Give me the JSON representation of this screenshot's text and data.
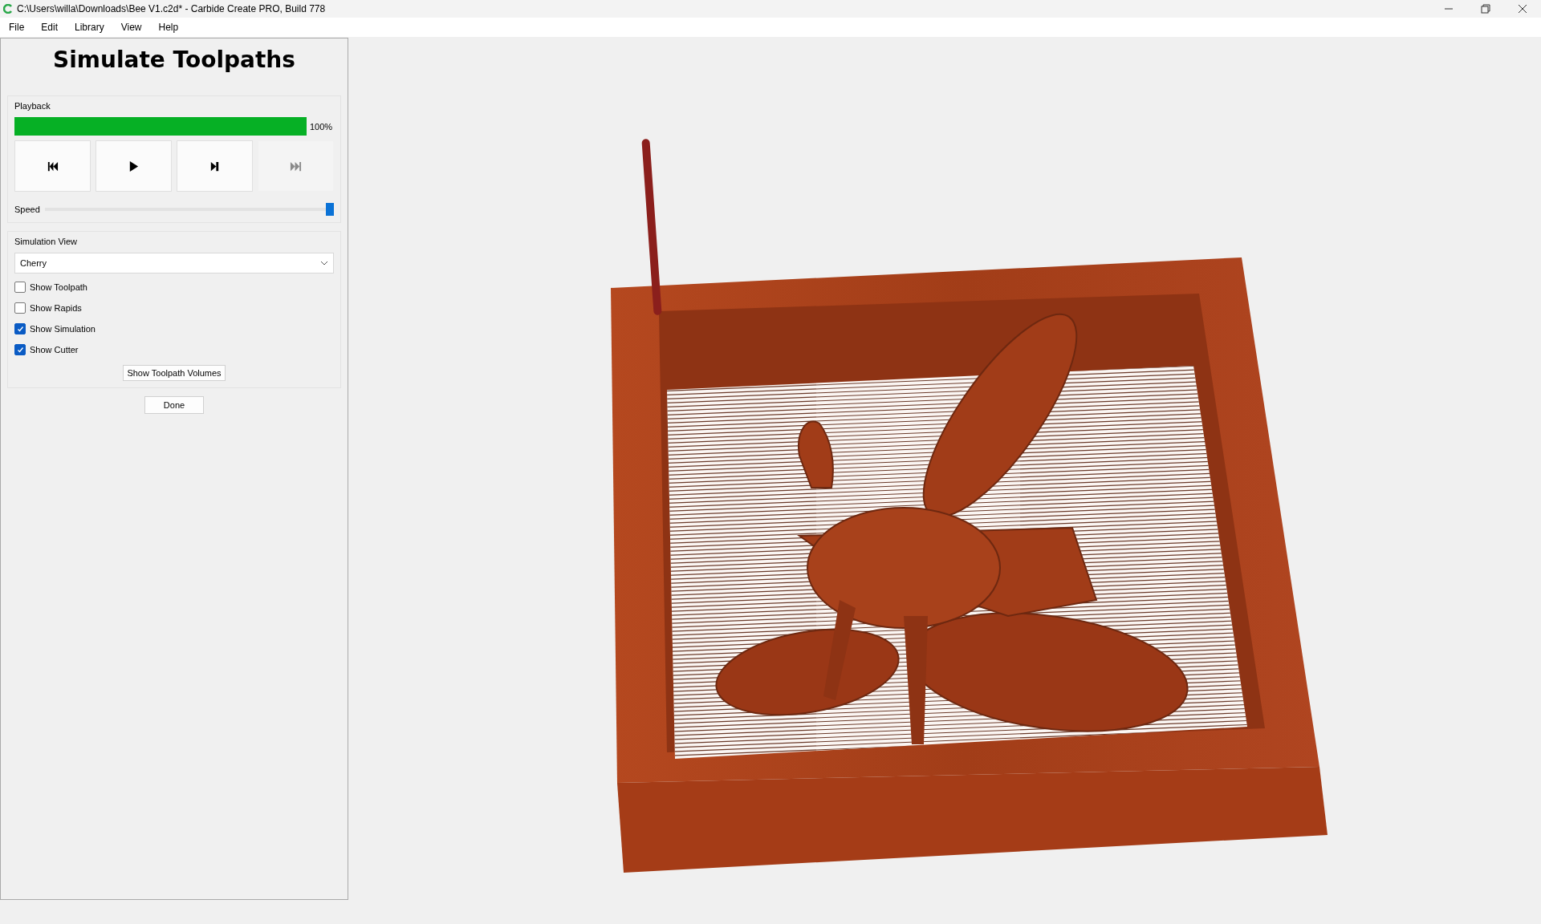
{
  "window": {
    "title": "C:\\Users\\willa\\Downloads\\Bee V1.c2d* - Carbide Create PRO, Build 778"
  },
  "menu": [
    {
      "label": "File"
    },
    {
      "label": "Edit"
    },
    {
      "label": "Library"
    },
    {
      "label": "View"
    },
    {
      "label": "Help"
    }
  ],
  "panel": {
    "title": "Simulate Toolpaths",
    "playback": {
      "label": "Playback",
      "progress": {
        "level": 1.0,
        "reading": "100%"
      },
      "buttons": [
        {
          "kind": "rewind",
          "disabled": false
        },
        {
          "kind": "play",
          "disabled": false
        },
        {
          "kind": "step",
          "disabled": false
        },
        {
          "kind": "end",
          "disabled": true
        }
      ],
      "speed": {
        "label": "Speed",
        "level": 1.0
      }
    },
    "simulation_view": {
      "label": "Simulation View",
      "material": "Cherry",
      "options": [
        {
          "label": "Show Toolpath",
          "checked": false
        },
        {
          "label": "Show Rapids",
          "checked": false
        },
        {
          "label": "Show Simulation",
          "checked": true
        },
        {
          "label": "Show Cutter",
          "checked": true
        }
      ],
      "volumes_button": "Show Toolpath Volumes"
    },
    "done_button": "Done"
  }
}
